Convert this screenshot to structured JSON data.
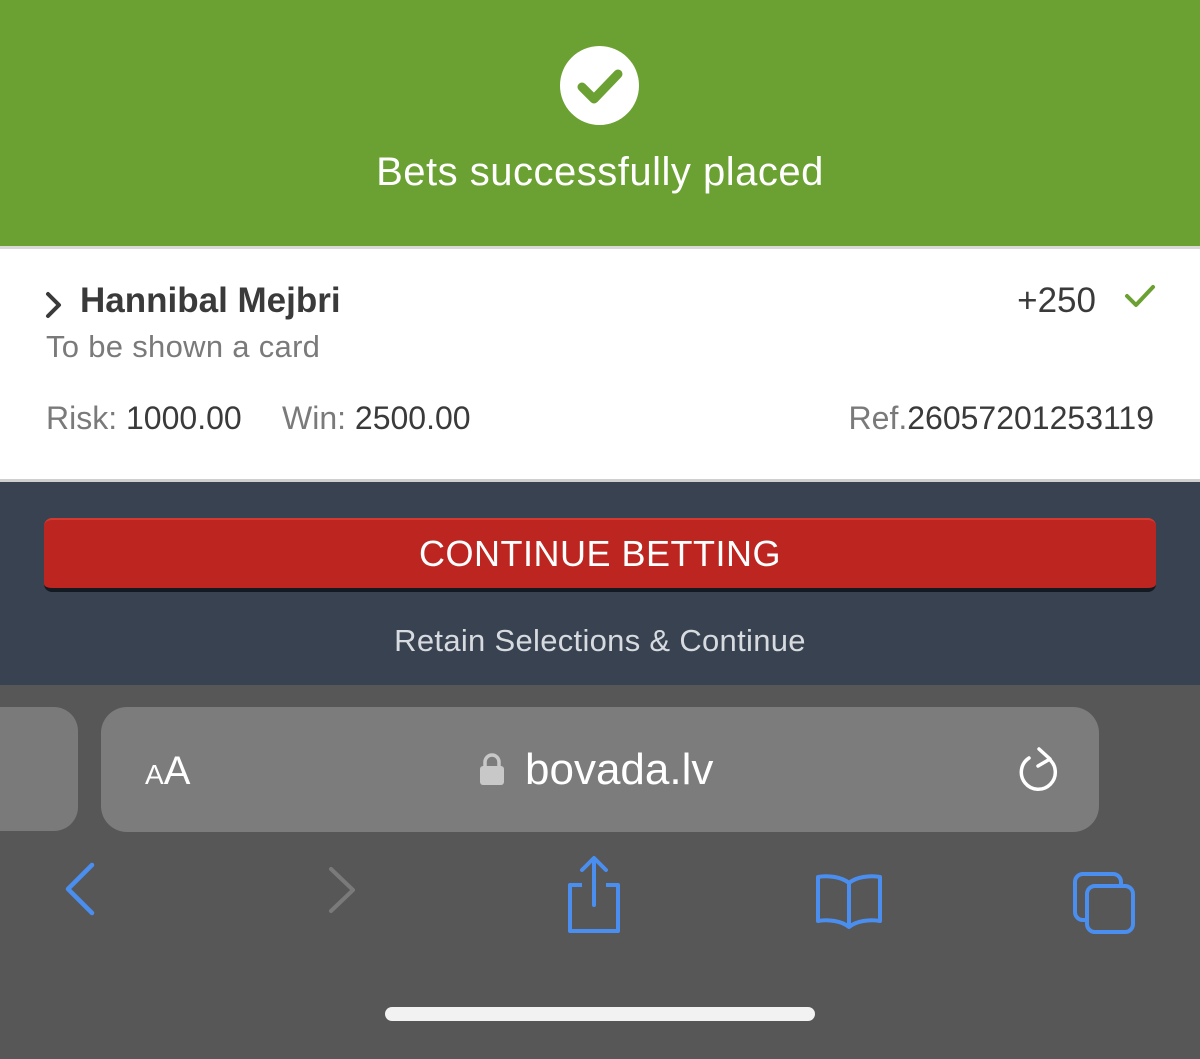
{
  "banner": {
    "title": "Bets successfully placed",
    "color": "#6aa132"
  },
  "bet": {
    "selection": "Hannibal Mejbri",
    "market": "To be shown a card",
    "odds": "+250",
    "risk_label": "Risk:",
    "risk_value": "1000.00",
    "win_label": "Win:",
    "win_value": "2500.00",
    "ref_label": "Ref.",
    "ref_value": "26057201253119"
  },
  "actions": {
    "continue_label": "CONTINUE BETTING",
    "retain_label": "Retain Selections & Continue",
    "continue_color": "#bd2620"
  },
  "browser": {
    "text_size_small": "A",
    "text_size_big": "A",
    "domain": "bovada.lv",
    "icons": [
      "lock-icon",
      "reload-icon",
      "back-icon",
      "forward-icon",
      "share-icon",
      "bookmarks-icon",
      "tabs-icon"
    ],
    "accent_color": "#4a8ef0"
  }
}
